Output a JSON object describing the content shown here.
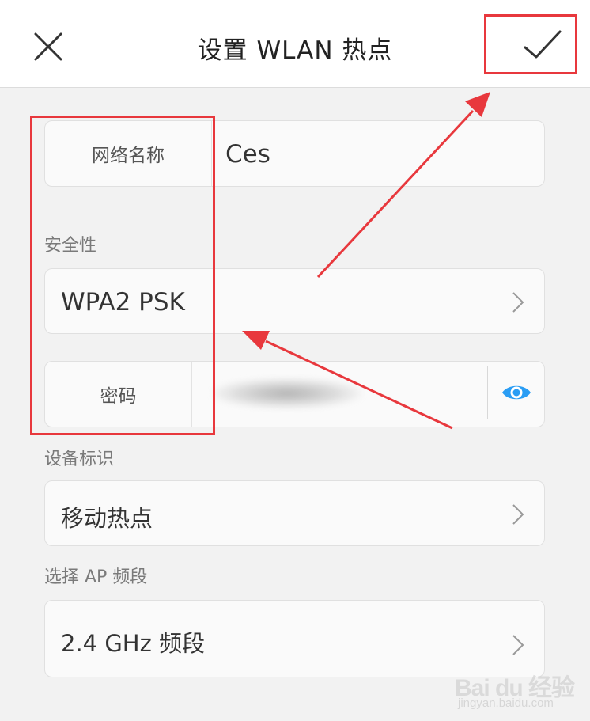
{
  "header": {
    "title": "设置 WLAN 热点",
    "close_icon": "close-icon",
    "confirm_icon": "checkmark-icon"
  },
  "form": {
    "network_name": {
      "label": "网络名称",
      "value": "Ces"
    },
    "security": {
      "section_label": "安全性",
      "value": "WPA2 PSK"
    },
    "password": {
      "label": "密码",
      "toggle_icon": "eye-icon"
    },
    "device_id": {
      "section_label": "设备标识",
      "value": "移动热点"
    },
    "ap_band": {
      "section_label": "选择 AP 频段",
      "value": "2.4 GHz 频段"
    }
  },
  "colors": {
    "accent": "#2a9df4",
    "annotation": "#e8383d",
    "background": "#f2f2f2"
  },
  "watermark": {
    "brand": "Bai du 经验",
    "url": "jingyan.baidu.com"
  }
}
